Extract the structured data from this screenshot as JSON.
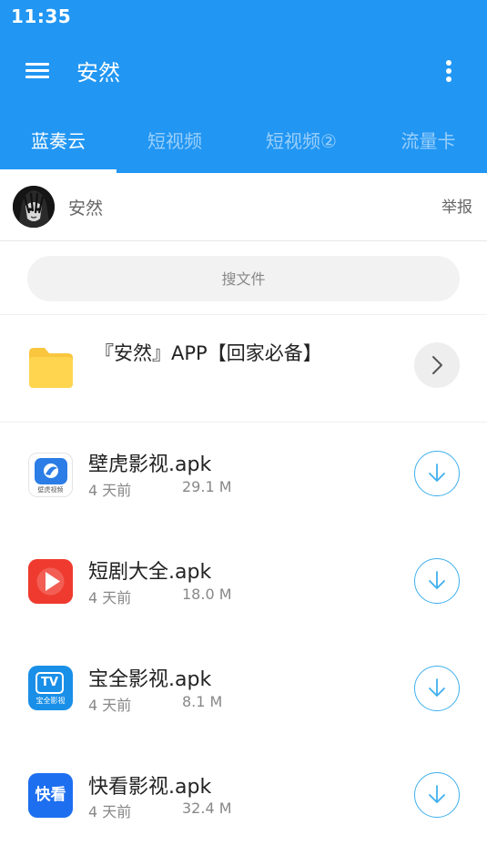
{
  "status_bar": {
    "time": "11:35"
  },
  "app_bar": {
    "title": "安然",
    "menu_icon": "hamburger-menu-icon",
    "more_icon": "more-vert-icon"
  },
  "tabs": [
    {
      "label": "蓝奏云",
      "active": true
    },
    {
      "label": "短视频",
      "active": false
    },
    {
      "label": "短视频②",
      "active": false
    },
    {
      "label": "流量卡",
      "active": false
    }
  ],
  "profile": {
    "name": "安然",
    "report_label": "举报"
  },
  "search": {
    "placeholder": "搜文件"
  },
  "folder": {
    "title": "『安然』APP【回家必备】",
    "icon": "folder-icon"
  },
  "files": [
    {
      "name": "壁虎影视.apk",
      "date": "4 天前",
      "size": "29.1 M",
      "icon": "bihu-app-icon",
      "icon_text": "壁虎视频"
    },
    {
      "name": "短剧大全.apk",
      "date": "4 天前",
      "size": "18.0 M",
      "icon": "duanju-app-icon"
    },
    {
      "name": "宝全影视.apk",
      "date": "4 天前",
      "size": "8.1 M",
      "icon": "baoquan-app-icon",
      "icon_text": "TV",
      "icon_subtext": "宝全影视"
    },
    {
      "name": "快看影视.apk",
      "date": "4 天前",
      "size": "32.4 M",
      "icon": "kuaikan-app-icon",
      "icon_text": "快看"
    }
  ],
  "colors": {
    "primary": "#2196F3",
    "download_accent": "#3fb0ee",
    "folder": "#FFD54F"
  }
}
